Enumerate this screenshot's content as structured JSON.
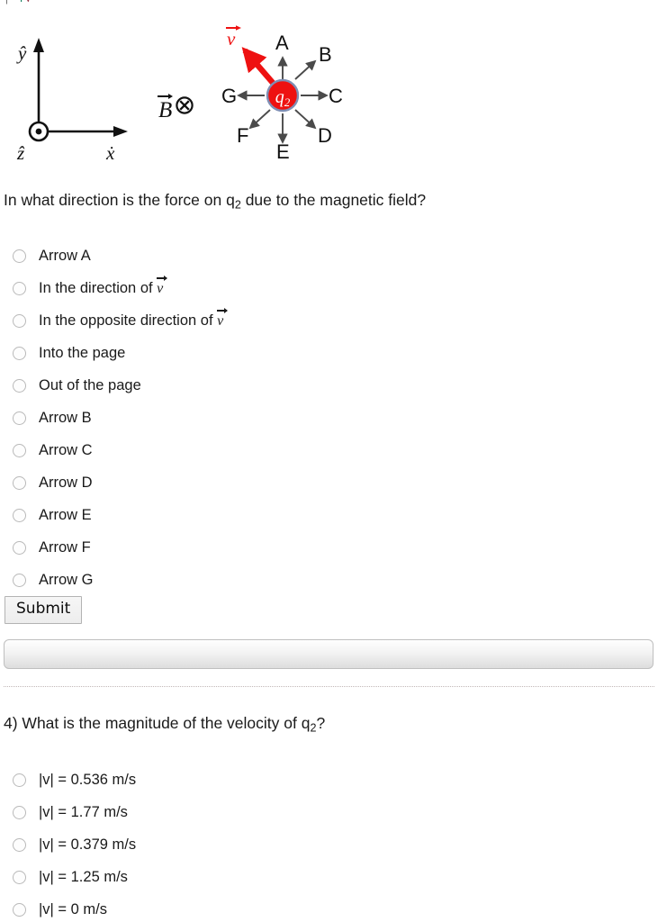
{
  "figure": {
    "axes": {
      "y_label": "ŷ",
      "x_label": "x̂",
      "z_label": "ẑ",
      "z_symbol": "out-of-page-dot"
    },
    "bfield": {
      "label": "B",
      "symbol": "into-page-cross",
      "description": "B vector into the page"
    },
    "charge": {
      "label": "q",
      "subscript": "2",
      "fill_color": "#ee1111",
      "stroke_color": "#7f8fb5"
    },
    "velocity": {
      "label": "v",
      "color": "#ee1111",
      "direction": "up-left"
    },
    "arrows": [
      {
        "letter": "A",
        "direction": "up"
      },
      {
        "letter": "B",
        "direction": "up-right"
      },
      {
        "letter": "C",
        "direction": "right"
      },
      {
        "letter": "D",
        "direction": "down-right"
      },
      {
        "letter": "E",
        "direction": "down"
      },
      {
        "letter": "F",
        "direction": "down-left"
      },
      {
        "letter": "G",
        "direction": "left"
      }
    ]
  },
  "question3": {
    "text_before": "In what direction is the force on q",
    "subscript": "2",
    "text_after": " due to the magnetic field?",
    "options": [
      {
        "text": "Arrow A",
        "has_vector": false
      },
      {
        "text_before": "In the direction of ",
        "has_vector": true,
        "vector": "v"
      },
      {
        "text_before": "In the opposite direction of ",
        "has_vector": true,
        "vector": "v"
      },
      {
        "text": "Into the page",
        "has_vector": false
      },
      {
        "text": "Out of the page",
        "has_vector": false
      },
      {
        "text": "Arrow B",
        "has_vector": false
      },
      {
        "text": "Arrow C",
        "has_vector": false
      },
      {
        "text": "Arrow D",
        "has_vector": false
      },
      {
        "text": "Arrow E",
        "has_vector": false
      },
      {
        "text": "Arrow F",
        "has_vector": false
      },
      {
        "text": "Arrow G",
        "has_vector": false
      }
    ],
    "submit_label": "Submit",
    "feedback": ""
  },
  "question4": {
    "number": "4)",
    "text_before": " What is the magnitude of the velocity of q",
    "subscript": "2",
    "text_after": "?",
    "options": [
      {
        "text": "|v| = 0.536 m/s"
      },
      {
        "text": "|v| = 1.77 m/s"
      },
      {
        "text": "|v| = 0.379 m/s"
      },
      {
        "text": "|v| = 1.25 m/s"
      },
      {
        "text": "|v| = 0 m/s"
      }
    ]
  },
  "artifact": {
    "glyph1": "|",
    "glyph2": "4",
    "glyph3": "v"
  }
}
